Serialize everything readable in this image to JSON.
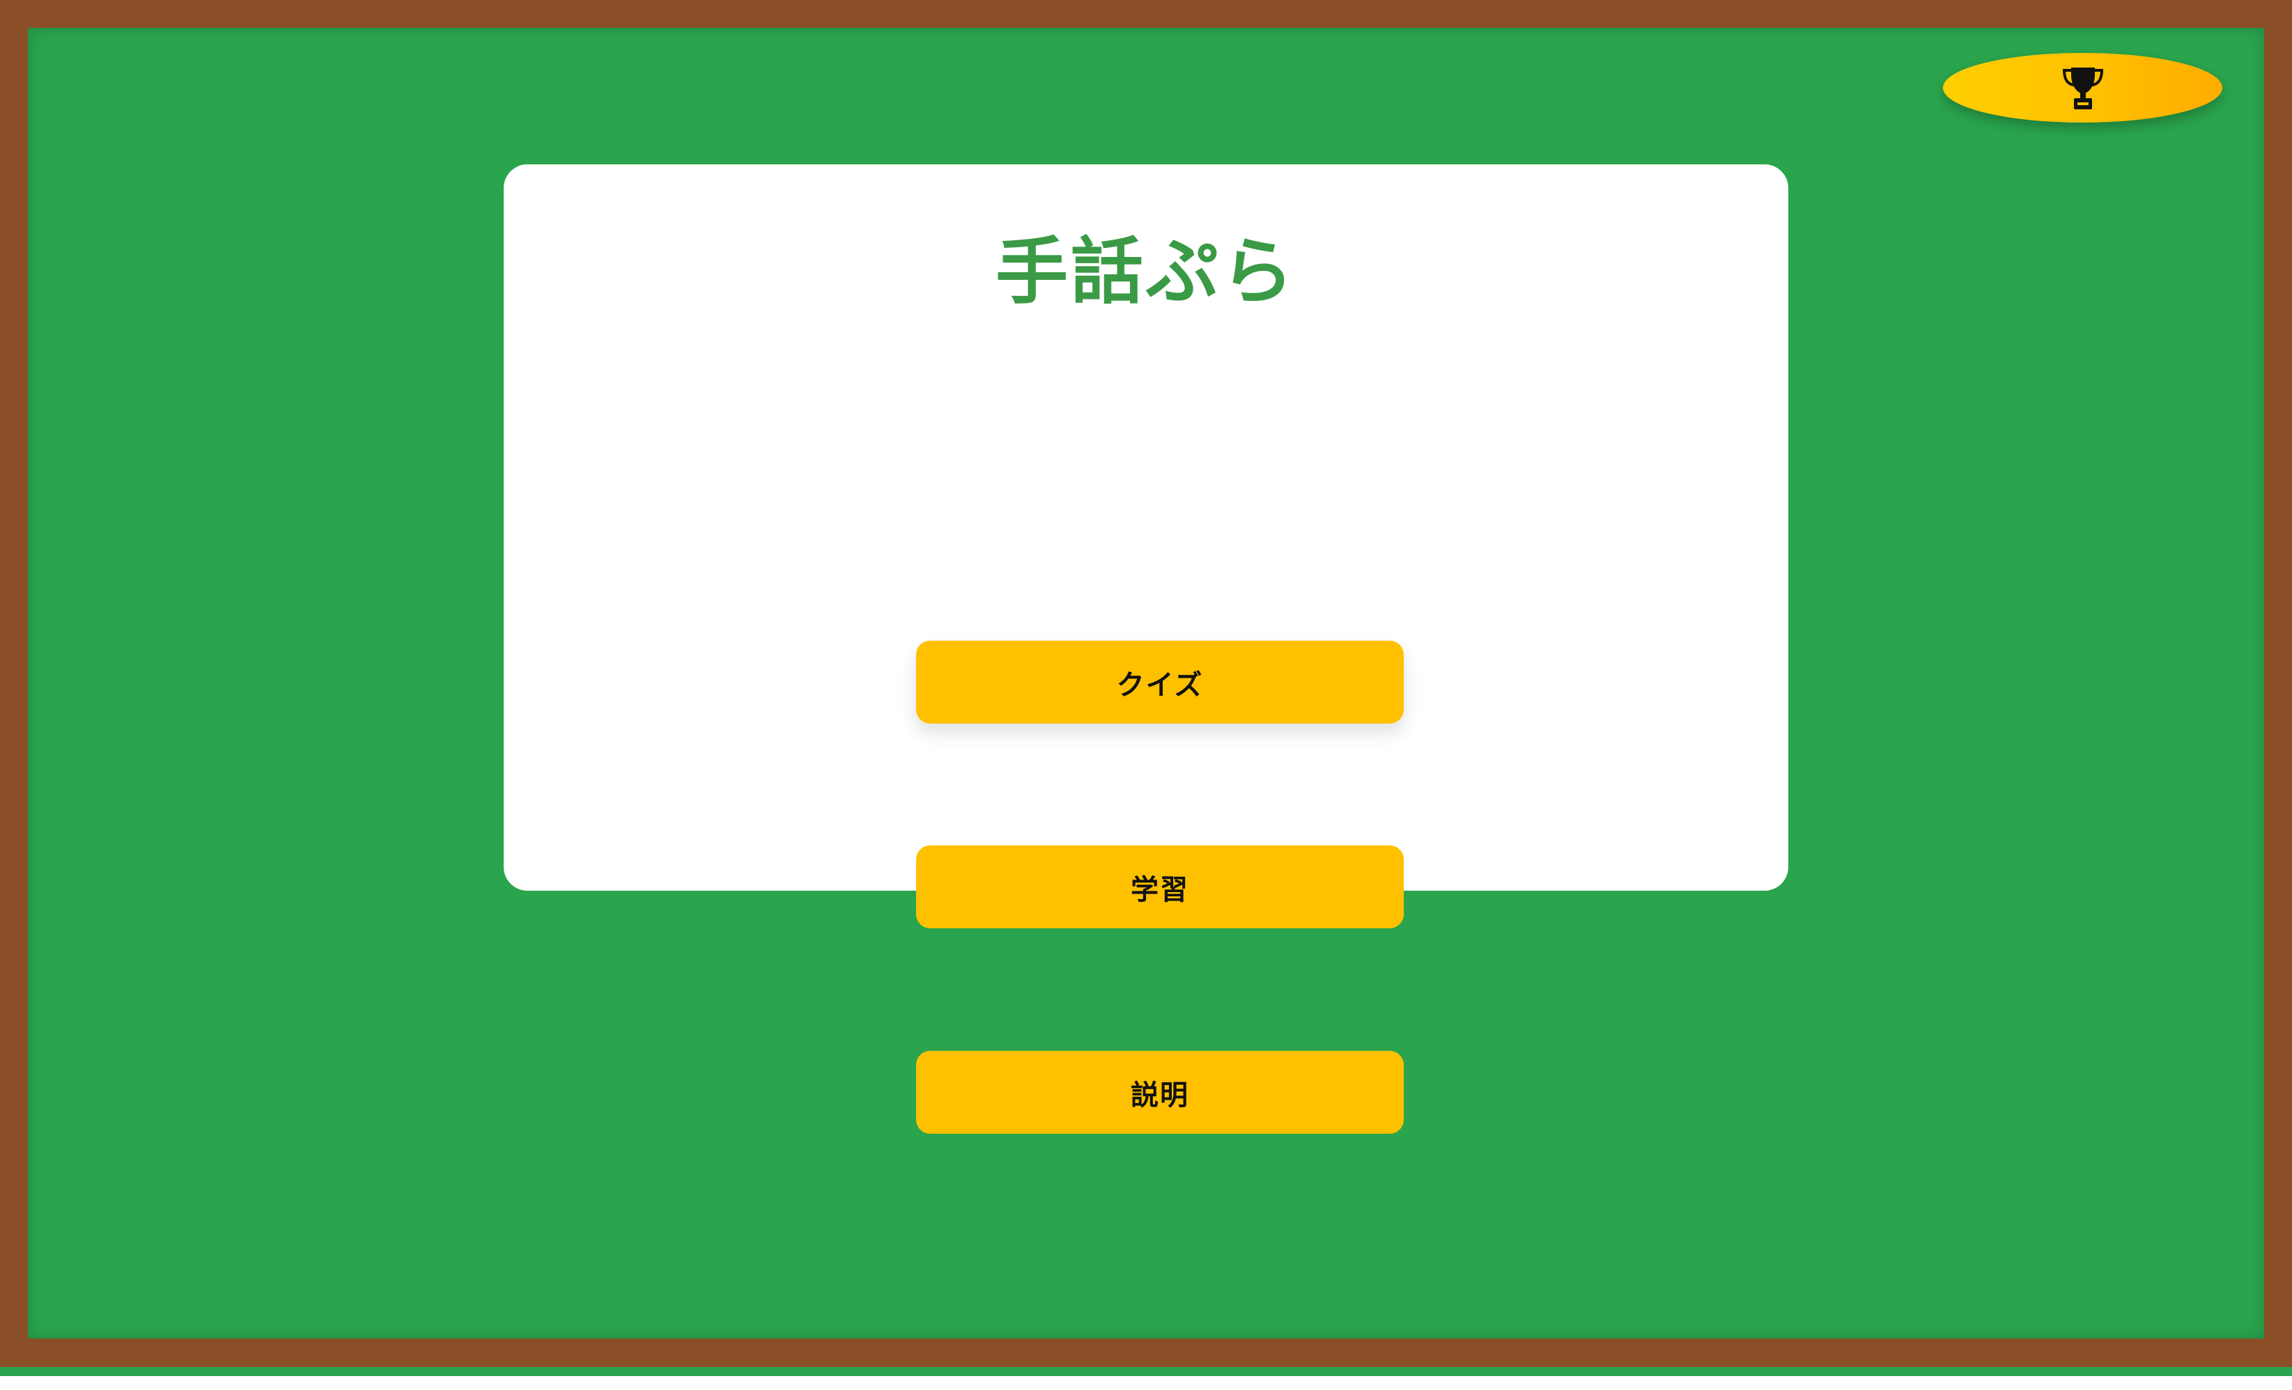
{
  "app": {
    "title": "手話ぷら"
  },
  "header": {
    "ranking_button": {
      "icon": "trophy-icon"
    }
  },
  "menu": {
    "quiz_label": "クイズ",
    "study_label": "学習",
    "explain_label": "説明"
  },
  "colors": {
    "frame": "#8a4f27",
    "board": "#2aa54d",
    "card": "#ffffff",
    "title": "#3a9a45",
    "button": "#ffc000",
    "button_text": "#111111"
  }
}
